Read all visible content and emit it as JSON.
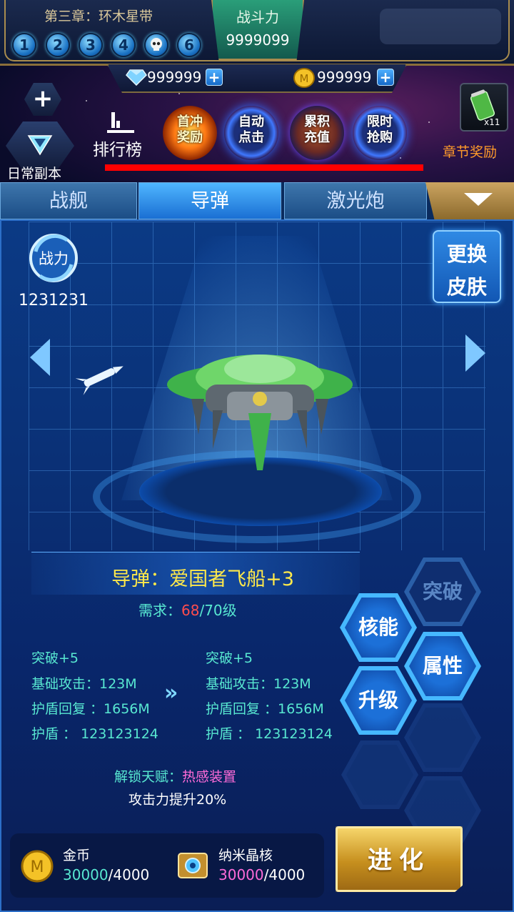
{
  "header": {
    "chapter_title": "第三章：环木星带",
    "stages": [
      "1",
      "2",
      "3",
      "4",
      "",
      "6"
    ],
    "power_label": "战斗力",
    "power_value": "9999099",
    "diamonds": "999999",
    "coins": "999999"
  },
  "side_menu": {
    "plus_label": "+",
    "daily_dungeon": "日常副本",
    "ranking": "排行榜"
  },
  "events": [
    {
      "line1": "首冲",
      "line2": "奖励"
    },
    {
      "line1": "自动",
      "line2": "点击"
    },
    {
      "line1": "累积",
      "line2": "充值"
    },
    {
      "line1": "限时",
      "line2": "抢购"
    }
  ],
  "chapter_reward": {
    "count": "x11",
    "label": "章节奖励"
  },
  "tabs": [
    {
      "label": "战舰",
      "active": false
    },
    {
      "label": "导弹",
      "active": true
    },
    {
      "label": "激光炮",
      "active": false
    }
  ],
  "combat": {
    "icon_label": "战力",
    "value": "1231231"
  },
  "skin_button": {
    "line1": "更换",
    "line2": "皮肤"
  },
  "item": {
    "title": "导弹：爱国者飞船+3",
    "req_label": "需求：",
    "req_current": "68",
    "req_rest": "/70级"
  },
  "stats": {
    "current": [
      "突破+5",
      "基础攻击：123M",
      "护盾回复 ：1656M",
      "护盾 ： 123123124"
    ],
    "next": [
      "突破+5",
      "基础攻击：123M",
      "护盾回复 ：1656M",
      "护盾 ： 123123124"
    ],
    "arrow": "»"
  },
  "talent": {
    "label": "解锁天赋：",
    "name": "热感装置",
    "desc": "攻击力提升20%"
  },
  "hex_buttons": {
    "breakthrough": "突破",
    "core": "核能",
    "attribute": "属性",
    "upgrade": "升级"
  },
  "costs": {
    "gold_label": "金币",
    "gold_have": "30000",
    "gold_need": "/4000",
    "nano_label": "纳米晶核",
    "nano_have": "30000",
    "nano_need": "/4000"
  },
  "evolve_label": "进化",
  "colors": {
    "accent_blue": "#46b8ff",
    "highlight_yellow": "#ffe94a",
    "teal": "#58e8d1",
    "red": "#ff4d4d",
    "magenta": "#ff6bd8",
    "gold": "#f6d56a"
  }
}
